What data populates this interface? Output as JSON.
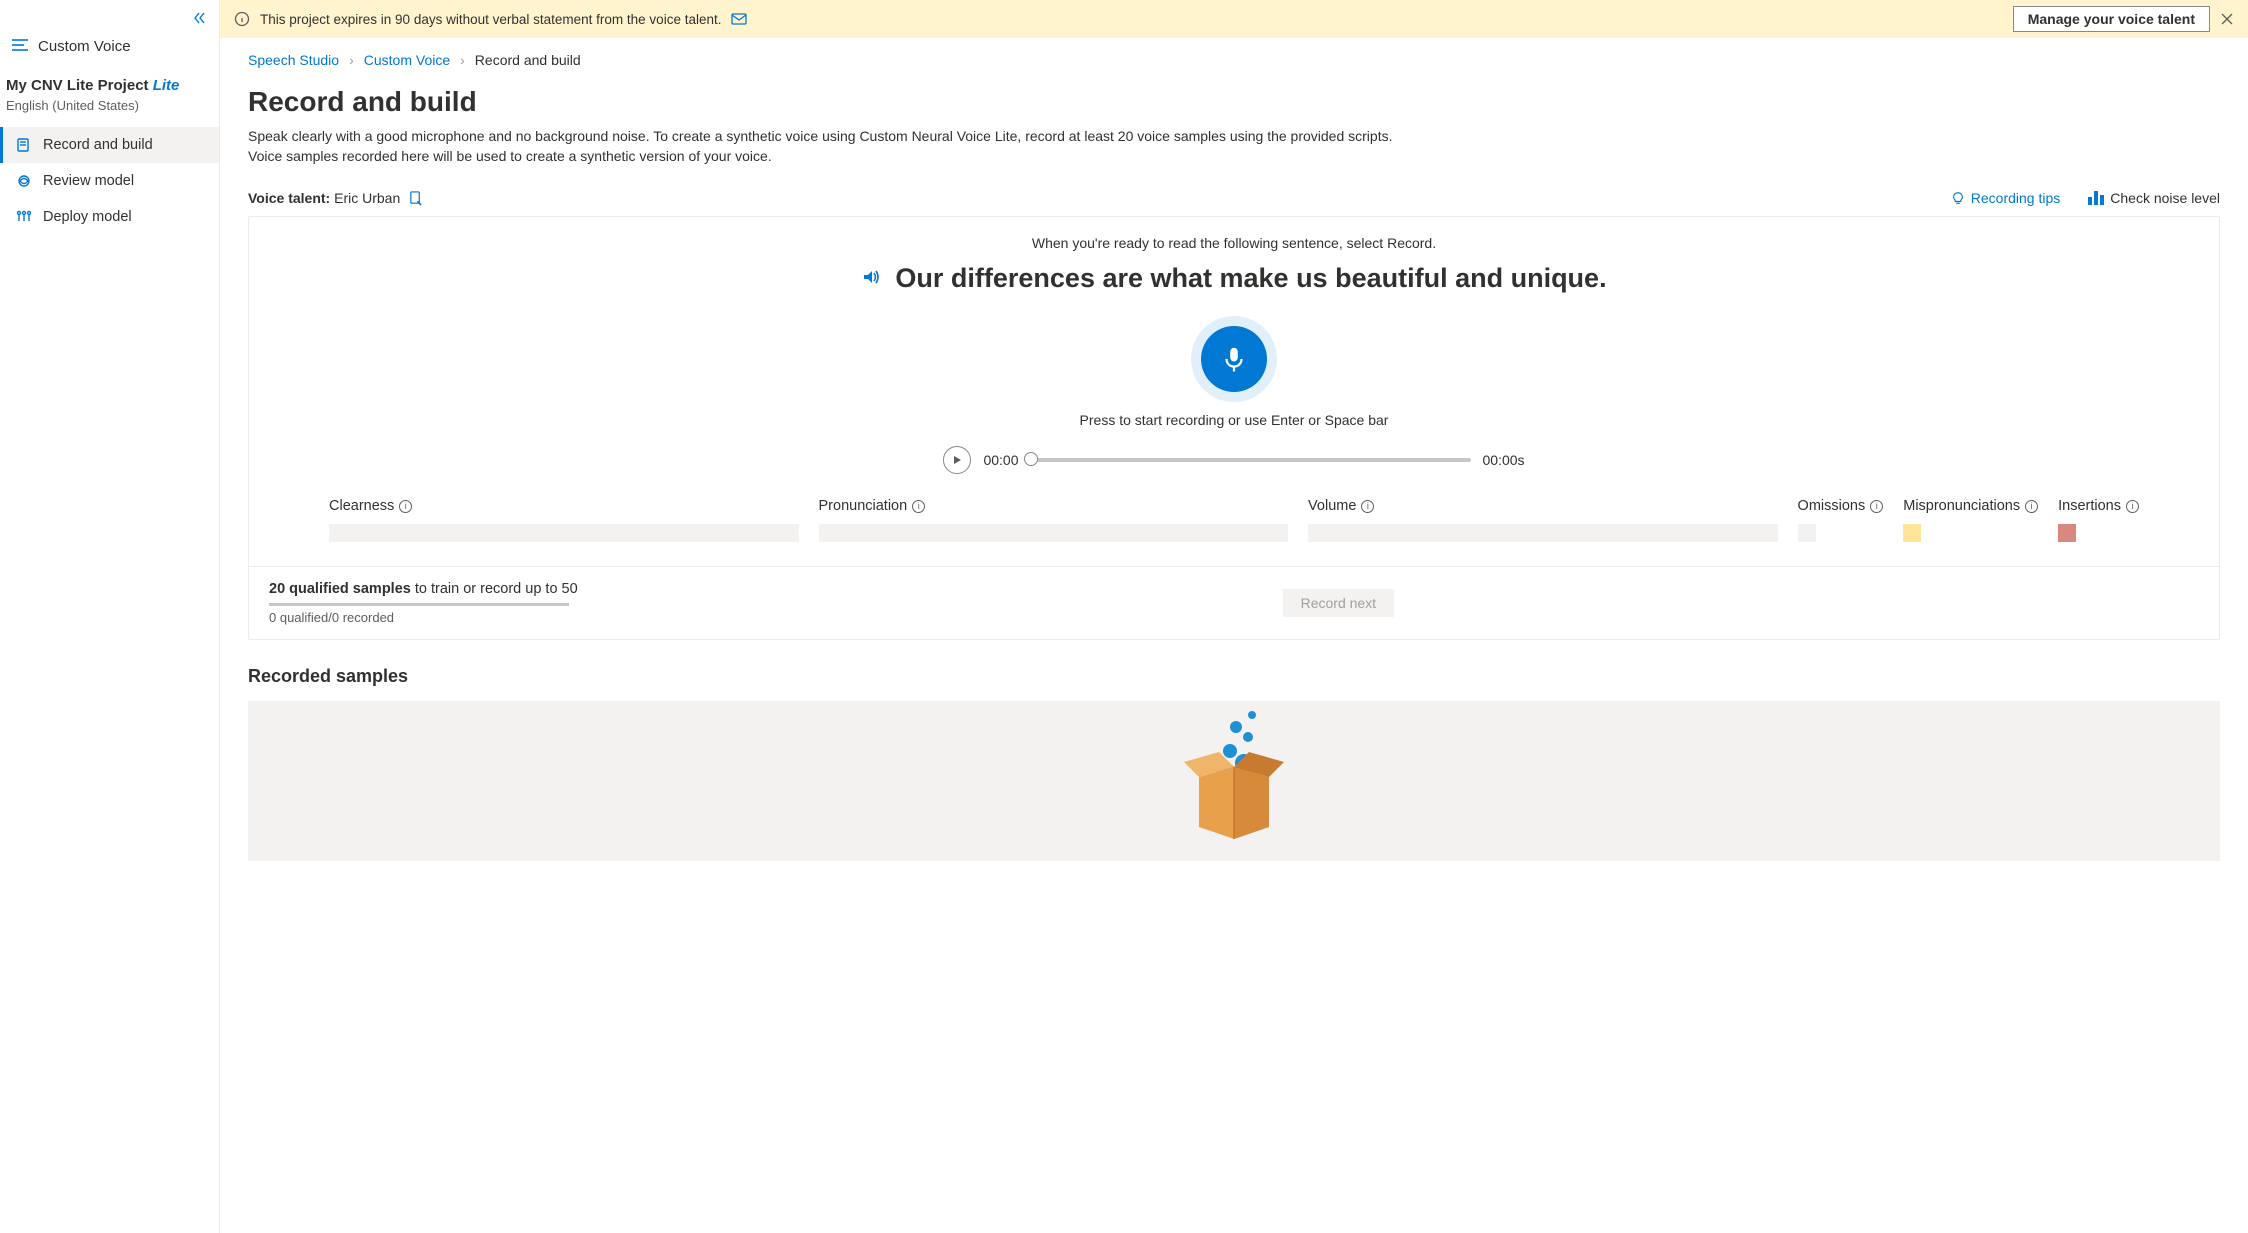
{
  "sidebar": {
    "product": "Custom Voice",
    "project_name": "My CNV Lite Project",
    "project_badge": "Lite",
    "language": "English (United States)",
    "items": [
      {
        "label": "Record and build",
        "active": true
      },
      {
        "label": "Review model",
        "active": false
      },
      {
        "label": "Deploy model",
        "active": false
      }
    ]
  },
  "banner": {
    "text": "This project expires in 90 days without verbal statement from the voice talent.",
    "button": "Manage your voice talent"
  },
  "breadcrumb": {
    "items": [
      "Speech Studio",
      "Custom Voice"
    ],
    "current": "Record and build"
  },
  "page": {
    "title": "Record and build",
    "desc": "Speak clearly with a good microphone and no background noise. To create a synthetic voice using Custom Neural Voice Lite, record at least 20 voice samples using the provided scripts. Voice samples recorded here will be used to create a synthetic version of your voice."
  },
  "talent": {
    "label": "Voice talent",
    "name": "Eric Urban",
    "tips": "Recording tips",
    "noise": "Check noise level"
  },
  "card": {
    "instruction": "When you're ready to read the following sentence, select Record.",
    "sentence": "Our differences are what make us beautiful and unique.",
    "hint": "Press to start recording or use Enter or Space bar",
    "time_current": "00:00",
    "time_total": "00:00s",
    "metrics": {
      "clearness": "Clearness",
      "pronunciation": "Pronunciation",
      "volume": "Volume",
      "omissions": "Omissions",
      "mispronunciations": "Mispronunciations",
      "insertions": "Insertions"
    },
    "footer": {
      "strong": "20 qualified samples",
      "rest": " to train or record up to 50",
      "sub": "0 qualified/0 recorded",
      "button": "Record next"
    }
  },
  "section": {
    "recorded_title": "Recorded samples"
  }
}
